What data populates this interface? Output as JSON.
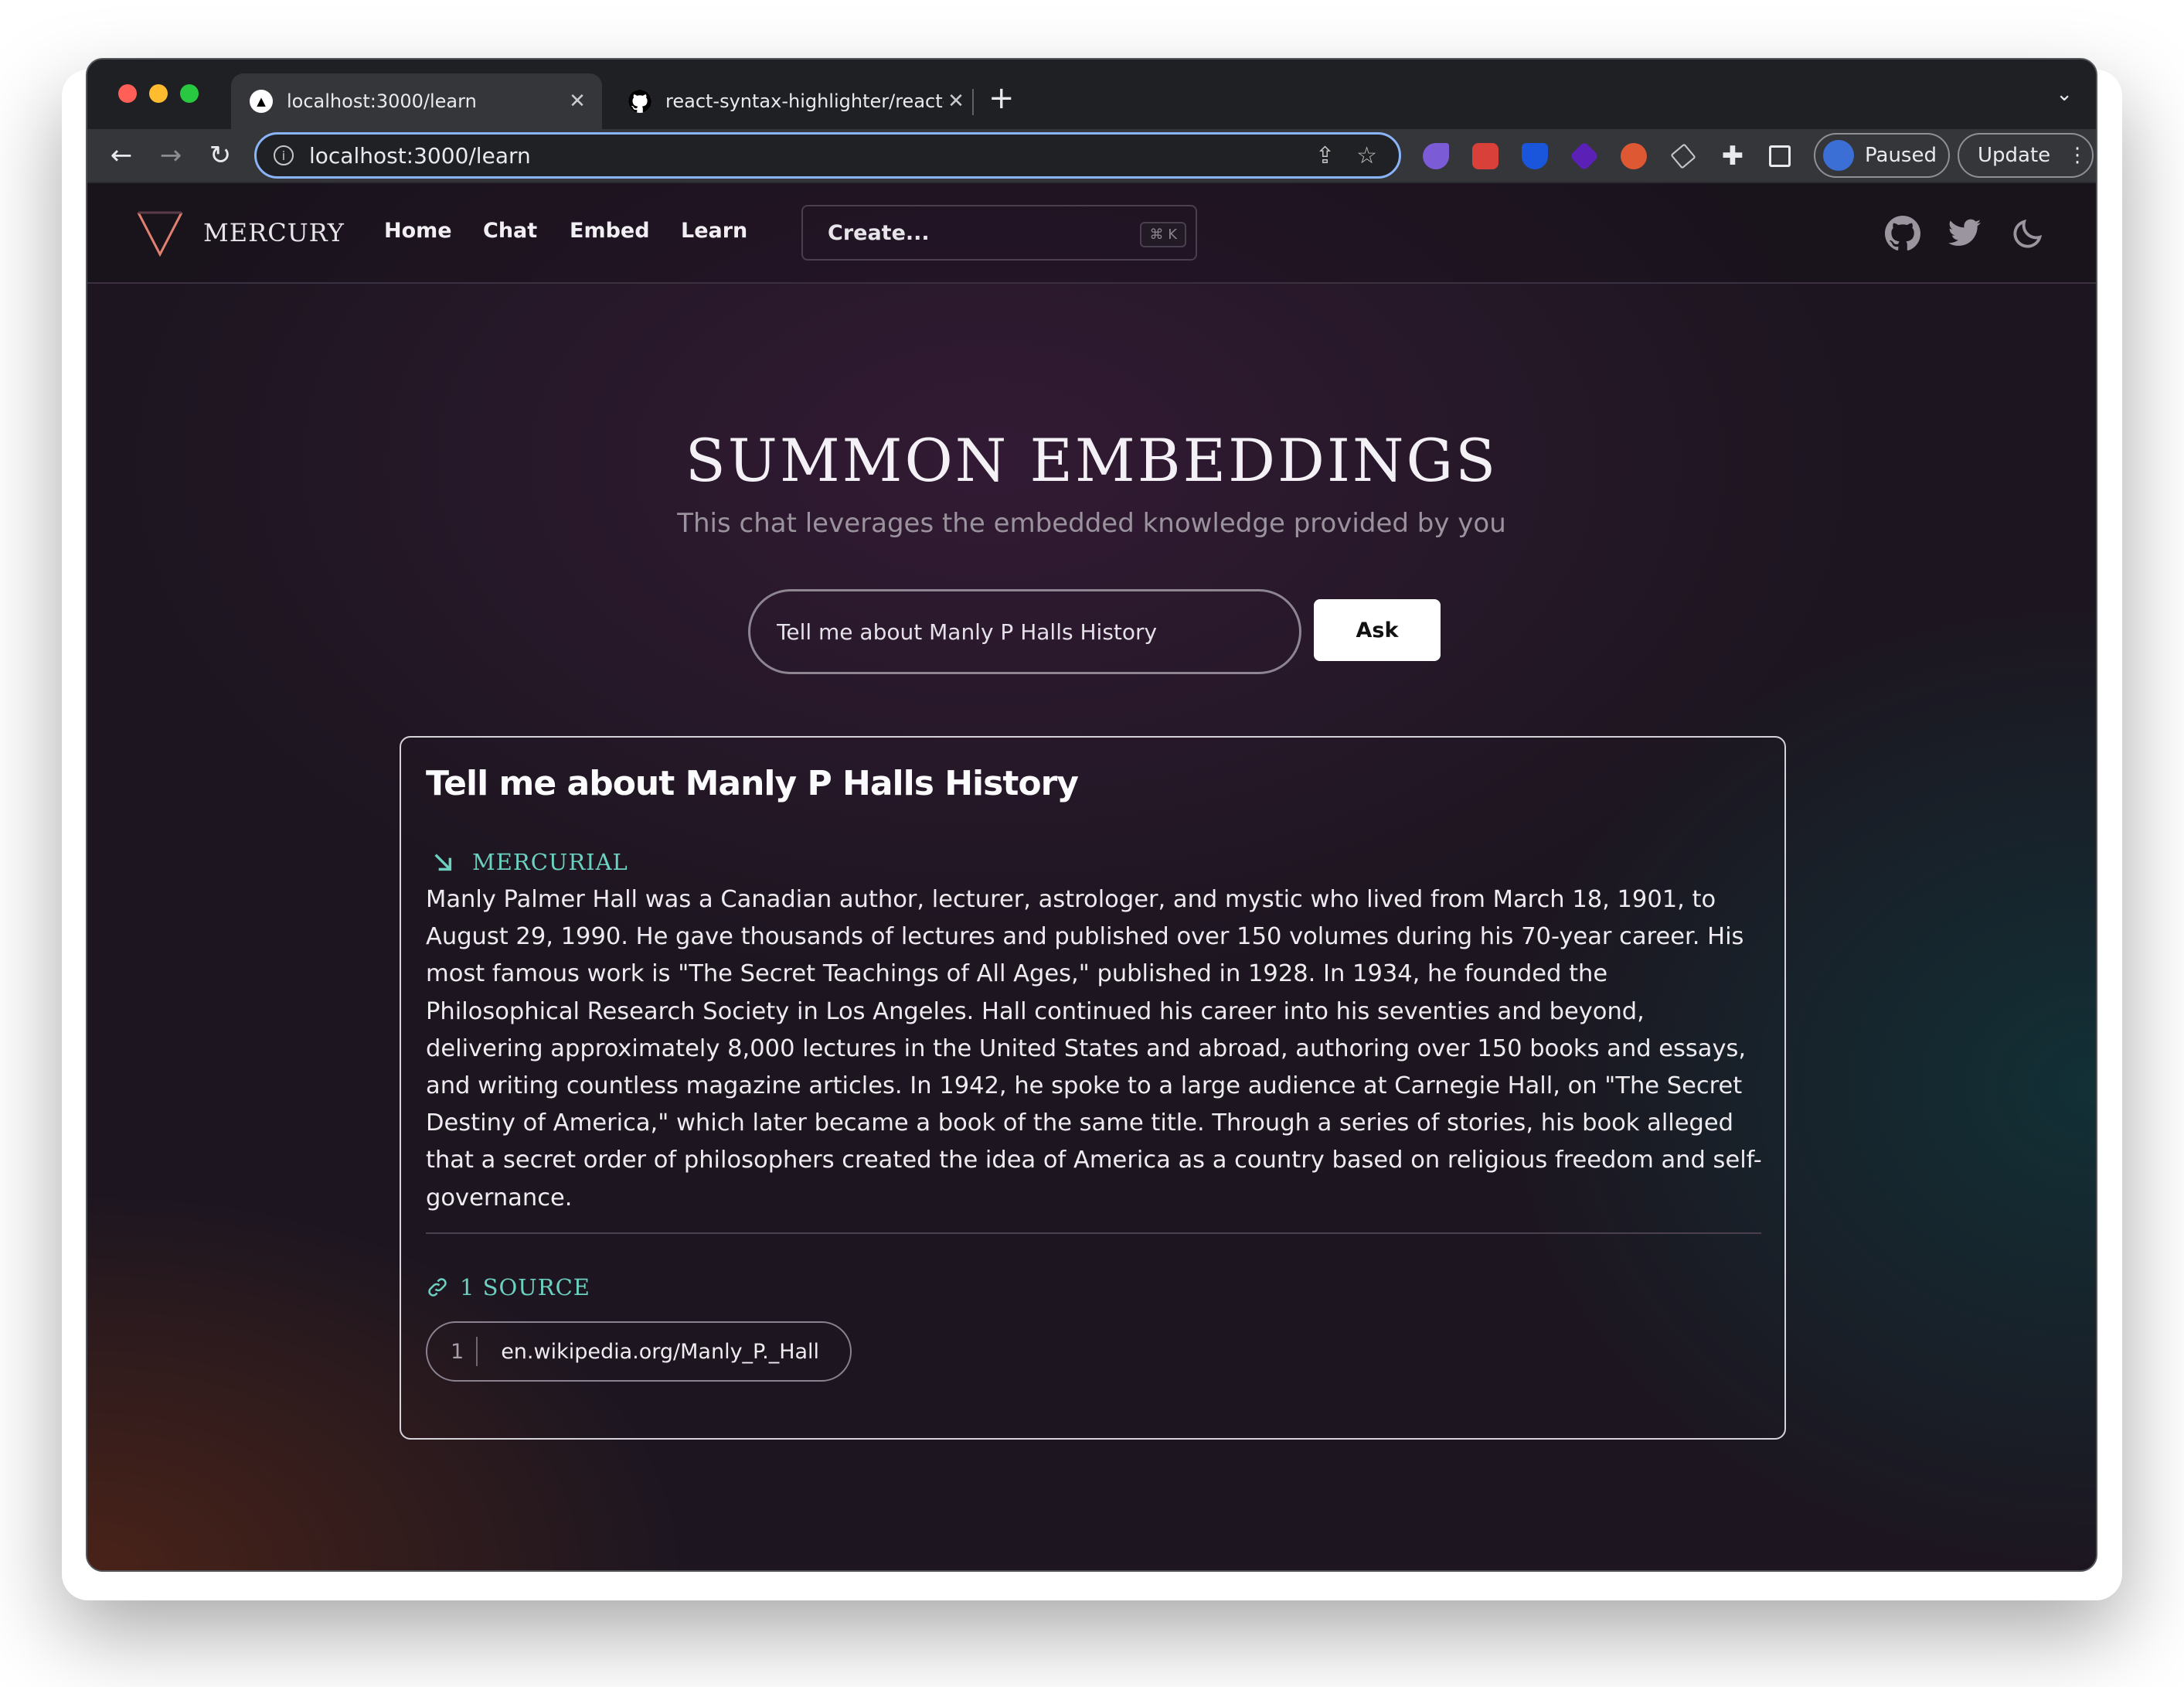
{
  "browser": {
    "tabs": [
      {
        "title": "localhost:3000/learn",
        "active": true,
        "icon": "triangle-favicon"
      },
      {
        "title": "react-syntax-highlighter/react-",
        "active": false,
        "icon": "github-favicon"
      }
    ],
    "url": "localhost:3000/learn",
    "profile_label": "Paused",
    "update_label": "Update"
  },
  "app": {
    "brand": "MERCURY",
    "nav": [
      {
        "label": "Home"
      },
      {
        "label": "Chat"
      },
      {
        "label": "Embed"
      },
      {
        "label": "Learn"
      }
    ],
    "command": {
      "placeholder": "Create...",
      "shortcut": "⌘ K"
    },
    "icons": [
      "github-icon",
      "twitter-icon",
      "moon-icon"
    ]
  },
  "hero": {
    "title": "SUMMON EMBEDDINGS",
    "subtitle": "This chat leverages the embedded knowledge provided by you"
  },
  "query": {
    "value": "Tell me about Manly P Halls History",
    "button": "Ask"
  },
  "result": {
    "question": "Tell me about Manly P Halls History",
    "agent": "MERCURIAL",
    "answer": "Manly Palmer Hall was a Canadian author, lecturer, astrologer, and mystic who lived from March 18, 1901, to August 29, 1990. He gave thousands of lectures and published over 150 volumes during his 70-year career. His most famous work is \"The Secret Teachings of All Ages,\" published in 1928. In 1934, he founded the Philosophical Research Society in Los Angeles. Hall continued his career into his seventies and beyond, delivering approximately 8,000 lectures in the United States and abroad, authoring over 150 books and essays, and writing countless magazine articles. In 1942, he spoke to a large audience at Carnegie Hall, on \"The Secret Destiny of America,\" which later became a book of the same title. Through a series of stories, his book alleged that a secret order of philosophers created the idea of America as a country based on religious freedom and self-governance.",
    "sources_label": "1 SOURCE",
    "sources": [
      {
        "index": "1",
        "url": "en.wikipedia.org/Manly_P._Hall"
      }
    ]
  },
  "colors": {
    "accent": "#6cd1c0",
    "page_bg": "#2a1b2e",
    "card_border": "#d6d2d9"
  }
}
